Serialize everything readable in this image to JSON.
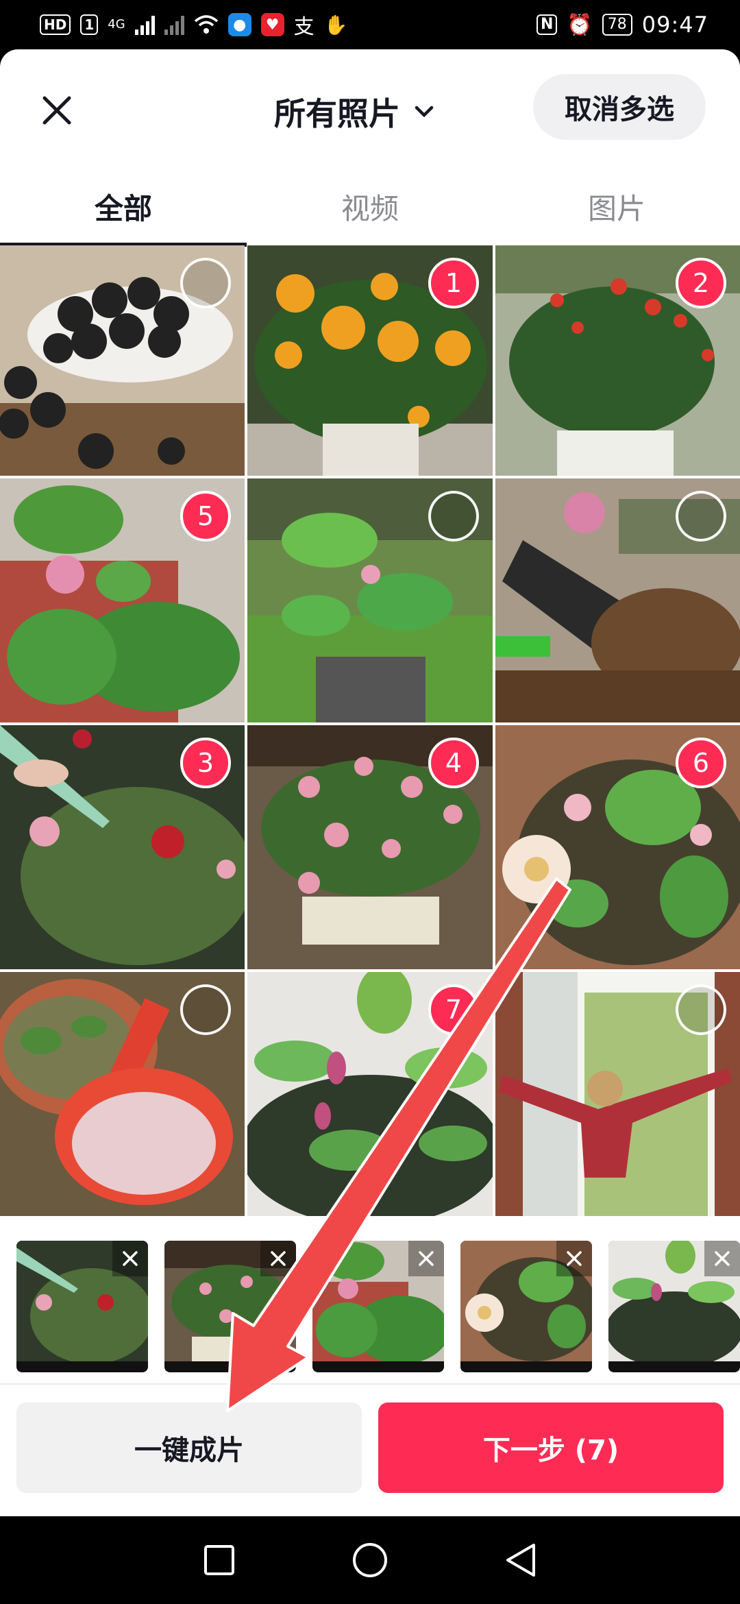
{
  "status_bar": {
    "hd_label": "HD",
    "sim_label": "1",
    "net_1": "4G",
    "time": "09:47",
    "battery": "78",
    "nfc_label": "N",
    "pay_label": "支"
  },
  "header": {
    "title": "所有照片",
    "cancel_multi": "取消多选"
  },
  "tabs": [
    {
      "label": "全部",
      "active": true
    },
    {
      "label": "视频",
      "active": false
    },
    {
      "label": "图片",
      "active": false
    }
  ],
  "grid": [
    {
      "subject": "charcoal balls in bowl",
      "selected": ""
    },
    {
      "subject": "orange roses in pot",
      "selected": "1"
    },
    {
      "subject": "red rose bush on balcony",
      "selected": "2"
    },
    {
      "subject": "pink lotus with leaves",
      "selected": "5"
    },
    {
      "subject": "lotus plant in garden pot",
      "selected": ""
    },
    {
      "subject": "shovel with soil",
      "selected": ""
    },
    {
      "subject": "watering red rose plant",
      "selected": "3"
    },
    {
      "subject": "pink roses in planter",
      "selected": "4"
    },
    {
      "subject": "white lotus in pot",
      "selected": "6"
    },
    {
      "subject": "fertilizer scoop over pot",
      "selected": ""
    },
    {
      "subject": "lotus buds in pond pot",
      "selected": "7"
    },
    {
      "subject": "person at open window",
      "selected": ""
    }
  ],
  "tray": [
    {
      "subject": "watering red rose plant"
    },
    {
      "subject": "pink roses in planter"
    },
    {
      "subject": "pink lotus with leaves"
    },
    {
      "subject": "white lotus in pot"
    },
    {
      "subject": "lotus buds in pond pot"
    }
  ],
  "buttons": {
    "one_click": "一键成片",
    "next": "下一步 (7)"
  },
  "colors": {
    "accent": "#fe2c55",
    "arrow": "#f04848"
  }
}
